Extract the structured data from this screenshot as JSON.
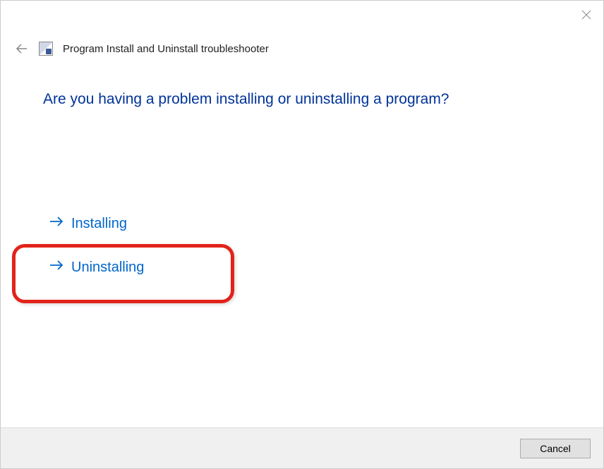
{
  "window": {
    "title": "Program Install and Uninstall troubleshooter"
  },
  "main": {
    "heading": "Are you having a problem installing or uninstalling a program?",
    "options": [
      {
        "label": "Installing"
      },
      {
        "label": "Uninstalling"
      }
    ]
  },
  "footer": {
    "cancel_label": "Cancel"
  }
}
